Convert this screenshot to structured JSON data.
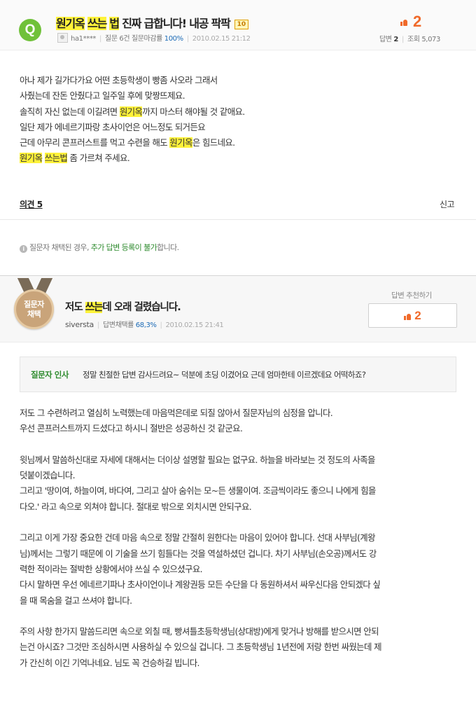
{
  "question": {
    "badge": "Q",
    "title_parts": [
      "원기옥",
      " ",
      "쓰는",
      " ",
      "법",
      " 진짜 급합니다! 내공 팍팍"
    ],
    "bounty": "10",
    "author": "ha1****",
    "question_count": "질문 6건",
    "accept_rate_label": "질문마감률",
    "accept_rate": "100%",
    "date": "2010.02.15 21:12",
    "likes": "2",
    "answers_label": "답변",
    "answers": "2",
    "views_label": "조회",
    "views": "5,073",
    "body": {
      "l1": "아나 제가 길가다가요 어떤 초등학생이 빵좀 사오라 그래서",
      "l2": "사줬는데 잔돈 안줬다고 일주일 후에 맞짱뜨제요.",
      "l3a": " 솔직히 자신 없는데 이길려면 ",
      "l3b": "원기옥",
      "l3c": "까지 마스터 해야될 것 같애요.",
      "l4": " 일단 제가 에네르기파랑 초사이언은 어느정도 되거든요",
      "l5a": "근데 아무리 콘프러스트를 먹고 수련을 해도 ",
      "l5b": "원기옥",
      "l5c": "은 힘드네요.",
      "l6a": "원기옥",
      "l6b": " ",
      "l6c": "쓰는법",
      "l6d": " 좀 가르쳐 주세요."
    },
    "opinions": "의견 5",
    "report": "신고"
  },
  "notice": {
    "pre": "질문자 채택된 경우, ",
    "green": "추가 답변 등록이 불가",
    "post": "합니다."
  },
  "answer": {
    "medal_line1": "질문자",
    "medal_line2": "채택",
    "title_pre": "저도 ",
    "title_hl": "쓰는",
    "title_post": "데 오래 걸렸습니다.",
    "author": "siversta",
    "accept_rate_label": "답변채택률",
    "accept_rate": "68,3%",
    "date": "2010.02.15 21:41",
    "recommend_label": "답변 추천하기",
    "likes": "2",
    "thanks_label": "질문자 인사",
    "thanks_text": "정말 친절한 답변 감사드려요~ 덕분에 초딩 이겼어요 근데 엄마한테 이르겠데요 어떡하죠?",
    "body": {
      "p1l1": "저도 그 수련하려고 열심히 노력했는데 마음먹은데로 되질 않아서 질문자님의 심정을 압니다.",
      "p1l2": "우선 콘프러스트까지 드셨다고 하시니 절반은 성공하신 것 같군요.",
      "p2l1": "윗님께서 말씀하신대로 자세에 대해서는 더이상 설명할 필요는 없구요. 하늘을 바라보는 것 정도의 사족을",
      "p2l2": "덧붙이겠습니다.",
      "p2l3": "그리고 '땅이여, 하늘이여, 바다여, 그리고 살아 숨쉬는 모~든 생물이여. 조금씩이라도 좋으니 나에게 힘을",
      "p2l4": "다오.' 라고 속으로 외쳐야 합니다. 절대로 밖으로 외치시면 안되구요.",
      "p3l1": "그리고 이게 가장 중요한 건데 마음 속으로 정말 간절히 원한다는 마음이 있어야 합니다. 선대 사부님(계왕",
      "p3l2": "님)께서는 그렇기 때문에 이 기술을 쓰기 힘들다는 것을 역설하셨던 겁니다. 차기 사부님(손오공)께서도 강",
      "p3l3": "력한 적이라는 절박한 상황에서야 쓰실 수 있으셨구요.",
      "p3l4": "다시 말하면 우선 에네르기파나 초사이언이나 계왕권등 모든 수단을 다 동원하셔서 싸우신다음 안되겠다 싶",
      "p3l5": "을 때 목숨을 걸고 쓰셔야 합니다.",
      "p4l1": "주의 사항 한가지 말씀드리면 속으로 외칠 때, 빵셔틀초등학생님(상대방)에게 맞거나 방해를 받으시면 안되",
      "p4l2": "는건 아시죠? 그것만 조심하시면 사용하실 수 있으실 겁니다. 그 초등학생님 1년전에 저랑 한번 싸웠는데 제",
      "p4l3": "가 간신히 이긴 기억나네요. 님도 꼭 건승하길 빕니다."
    }
  },
  "colors": {
    "highlight": "#fff23a",
    "badge_green": "#70c13a",
    "like_orange": "#f06a2a",
    "notice_green": "#2e8b2e",
    "rate_blue": "#1d6bb6"
  }
}
